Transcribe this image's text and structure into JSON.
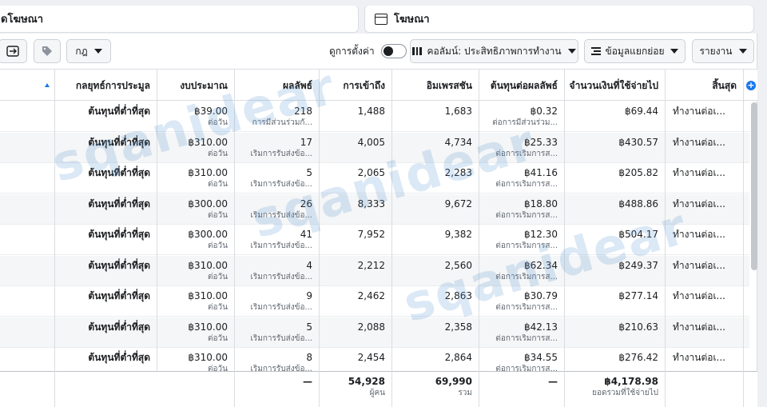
{
  "tabs": {
    "campaign_tab": "ดโฆษณา",
    "ads_tab": "โฆษณา"
  },
  "toolbar": {
    "rules_label": "กฎ",
    "view_settings_label": "ดูการตั้งค่า",
    "columns_label": "คอลัมน์: ประสิทธิภาพการทำงาน",
    "breakdown_label": "ข้อมูลแยกย่อย",
    "reports_label": "รายงาน"
  },
  "table": {
    "headers": [
      "กลยุทธ์การประมูล",
      "งบประมาณ",
      "ผลลัพธ์",
      "การเข้าถึง",
      "อิมเพรสชัน",
      "ต้นทุนต่อผลลัพธ์",
      "จำนวนเงินที่ใช้จ่ายไป",
      "สิ้นสุด"
    ],
    "rows": [
      {
        "bid": "ต้นทุนที่ต่ำที่สุด",
        "budget": "฿39.00",
        "budget_sub": "ต่อวัน",
        "results": "218",
        "results_sub": "การมีส่วนร่วมกั...",
        "reach": "1,488",
        "impressions": "1,683",
        "cpr": "฿0.32",
        "cpr_sub": "ต่อการมีส่วนร่วม...",
        "spent": "฿69.44",
        "ends": "ทำงานต่อเ..."
      },
      {
        "bid": "ต้นทุนที่ต่ำที่สุด",
        "budget": "฿310.00",
        "budget_sub": "ต่อวัน",
        "results": "17",
        "results_sub": "เริ่มการรับส่งข้อ...",
        "reach": "4,005",
        "impressions": "4,734",
        "cpr": "฿25.33",
        "cpr_sub": "ต่อการเริ่มการส...",
        "spent": "฿430.57",
        "ends": "ทำงานต่อเ..."
      },
      {
        "bid": "ต้นทุนที่ต่ำที่สุด",
        "budget": "฿310.00",
        "budget_sub": "ต่อวัน",
        "results": "5",
        "results_sub": "เริ่มการรับส่งข้อ...",
        "reach": "2,065",
        "impressions": "2,283",
        "cpr": "฿41.16",
        "cpr_sub": "ต่อการเริ่มการส...",
        "spent": "฿205.82",
        "ends": "ทำงานต่อเ..."
      },
      {
        "bid": "ต้นทุนที่ต่ำที่สุด",
        "budget": "฿300.00",
        "budget_sub": "ต่อวัน",
        "results": "26",
        "results_sub": "เริ่มการรับส่งข้อ...",
        "reach": "8,333",
        "impressions": "9,672",
        "cpr": "฿18.80",
        "cpr_sub": "ต่อการเริ่มการส...",
        "spent": "฿488.86",
        "ends": "ทำงานต่อเ..."
      },
      {
        "bid": "ต้นทุนที่ต่ำที่สุด",
        "budget": "฿300.00",
        "budget_sub": "ต่อวัน",
        "results": "41",
        "results_sub": "เริ่มการรับส่งข้อ...",
        "reach": "7,952",
        "impressions": "9,382",
        "cpr": "฿12.30",
        "cpr_sub": "ต่อการเริ่มการส...",
        "spent": "฿504.17",
        "ends": "ทำงานต่อเ..."
      },
      {
        "bid": "ต้นทุนที่ต่ำที่สุด",
        "budget": "฿310.00",
        "budget_sub": "ต่อวัน",
        "results": "4",
        "results_sub": "เริ่มการรับส่งข้อ...",
        "reach": "2,212",
        "impressions": "2,560",
        "cpr": "฿62.34",
        "cpr_sub": "ต่อการเริ่มการส...",
        "spent": "฿249.37",
        "ends": "ทำงานต่อเ..."
      },
      {
        "bid": "ต้นทุนที่ต่ำที่สุด",
        "budget": "฿310.00",
        "budget_sub": "ต่อวัน",
        "results": "9",
        "results_sub": "เริ่มการรับส่งข้อ...",
        "reach": "2,462",
        "impressions": "2,863",
        "cpr": "฿30.79",
        "cpr_sub": "ต่อการเริ่มการส...",
        "spent": "฿277.14",
        "ends": "ทำงานต่อเ..."
      },
      {
        "bid": "ต้นทุนที่ต่ำที่สุด",
        "budget": "฿310.00",
        "budget_sub": "ต่อวัน",
        "results": "5",
        "results_sub": "เริ่มการรับส่งข้อ...",
        "reach": "2,088",
        "impressions": "2,358",
        "cpr": "฿42.13",
        "cpr_sub": "ต่อการเริ่มการส...",
        "spent": "฿210.63",
        "ends": "ทำงานต่อเ..."
      },
      {
        "bid": "ต้นทุนที่ต่ำที่สุด",
        "budget": "฿310.00",
        "budget_sub": "ต่อวัน",
        "results": "8",
        "results_sub": "เริ่มการรับส่งข้อ...",
        "reach": "2,454",
        "impressions": "2,864",
        "cpr": "฿34.55",
        "cpr_sub": "ต่อการเริ่มการส...",
        "spent": "฿276.42",
        "ends": "ทำงานต่อเ..."
      }
    ],
    "summary": {
      "results": "—",
      "reach": "54,928",
      "reach_sub": "ผู้คน",
      "impressions": "69,990",
      "impressions_sub": "รวม",
      "cpr": "—",
      "spent": "฿4,178.98",
      "spent_sub": "ยอดรวมที่ใช้จ่ายไป"
    }
  },
  "watermark": "sqanidear",
  "icons": {
    "accent": "#1877f2"
  }
}
